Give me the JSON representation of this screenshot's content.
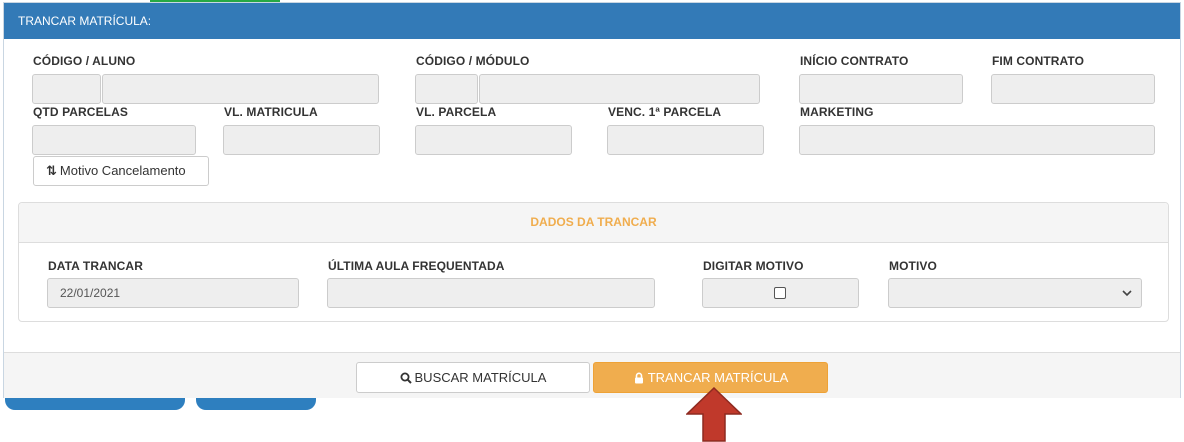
{
  "panel": {
    "title": "TRANCAR MATRÍCULA:"
  },
  "fields": {
    "codigo_aluno": "CÓDIGO / ALUNO",
    "codigo_modulo": "CÓDIGO / MÓDULO",
    "inicio_contrato": "INÍCIO CONTRATO",
    "fim_contrato": "FIM CONTRATO",
    "qtd_parcelas": "QTD PARCELAS",
    "vl_matricula": "VL. MATRICULA",
    "vl_parcela": "VL. PARCELA",
    "venc_parcela": "VENC. 1ª PARCELA",
    "marketing": "MARKETING"
  },
  "motivo_button": {
    "icon": "sort-arrows-icon",
    "label": "Motivo Cancelamento"
  },
  "dados": {
    "title": "DADOS DA TRANCAR",
    "data_trancar_label": "DATA TRANCAR",
    "data_trancar_value": "22/01/2021",
    "ultima_aula_label": "ÚLTIMA AULA FREQUENTADA",
    "digitar_motivo_label": "DIGITAR MOTIVO",
    "motivo_label": "MOTIVO"
  },
  "footer": {
    "buscar_label": "BUSCAR MATRÍCULA",
    "trancar_label": "TRANCAR MATRÍCULA"
  },
  "colors": {
    "header": "#337ab7",
    "accent_orange": "#f0ad4e",
    "arrow": "#c0392b"
  }
}
